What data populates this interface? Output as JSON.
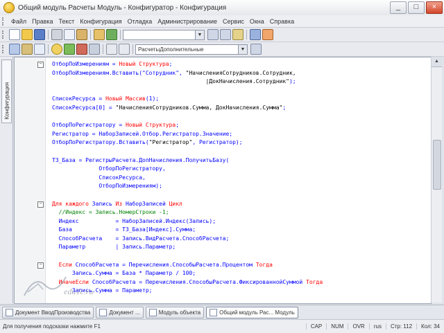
{
  "window": {
    "title": "Общий модуль Расчеты Модуль - Конфигуратор - Конфигурация",
    "min_label": "_",
    "max_label": "□",
    "close_label": "×"
  },
  "menu": {
    "items": [
      "Файл",
      "Правка",
      "Текст",
      "Конфигурация",
      "Отладка",
      "Администрирование",
      "Сервис",
      "Окна",
      "Справка"
    ]
  },
  "toolbar1": {
    "search_value": "",
    "icons": [
      "new-icon",
      "open-icon",
      "save-icon",
      "cut-icon",
      "copy-icon",
      "paste-icon",
      "undo-icon",
      "redo-icon",
      "find-icon",
      "replace-icon",
      "find-next-icon",
      "help-icon",
      "syntax-helper-icon"
    ]
  },
  "toolbar2": {
    "combo_value": "РасчетыДополнительные",
    "icons": [
      "config-icon",
      "db-icon",
      "window-icon",
      "debug-icon",
      "start-icon",
      "stop-icon",
      "step-icon",
      "module-icon",
      "procedure-icon"
    ]
  },
  "sidepanel": {
    "tab_label": "Конфигурация"
  },
  "editor": {
    "lines": [
      [
        {
          "t": "ОтборПоИзмерениям = ",
          "c": "#0000ff"
        },
        {
          "t": "Новый",
          "c": "#ff0000"
        },
        {
          "t": " ",
          "c": "#0000ff"
        },
        {
          "t": "Структура",
          "c": "#ff0000"
        },
        {
          "t": ";",
          "c": "#0000ff"
        }
      ],
      [
        {
          "t": "ОтборПоИзмерениям.Вставить(\"Сотрудник\", ",
          "c": "#0000ff"
        },
        {
          "t": "\"НачисленияСотрудников.Сотрудник,",
          "c": "#000000"
        }
      ],
      [
        {
          "t": "                                              |ДокНачисления.Сотрудник\"",
          "c": "#000000"
        },
        {
          "t": ");",
          "c": "#0000ff"
        }
      ],
      [
        {
          "t": "",
          "c": "#0000ff"
        }
      ],
      [
        {
          "t": "СписокРесурса = ",
          "c": "#0000ff"
        },
        {
          "t": "Новый Массив",
          "c": "#ff0000"
        },
        {
          "t": "(1);",
          "c": "#0000ff"
        }
      ],
      [
        {
          "t": "СписокРесурса[0] = ",
          "c": "#0000ff"
        },
        {
          "t": "\"НачисленияСотрудников.Сумма, ДокНачисления.Сумма\"",
          "c": "#000000"
        },
        {
          "t": ";",
          "c": "#0000ff"
        }
      ],
      [
        {
          "t": "",
          "c": "#0000ff"
        }
      ],
      [
        {
          "t": "ОтборПоРегистратору = ",
          "c": "#0000ff"
        },
        {
          "t": "Новый Структура",
          "c": "#ff0000"
        },
        {
          "t": ";",
          "c": "#0000ff"
        }
      ],
      [
        {
          "t": "Регистратор = НаборЗаписей.Отбор.Регистратор.Значение;",
          "c": "#0000ff"
        }
      ],
      [
        {
          "t": "ОтборПоРегистратору.Вставить(",
          "c": "#0000ff"
        },
        {
          "t": "\"Регистратор\"",
          "c": "#000000"
        },
        {
          "t": ", Регистратор);",
          "c": "#0000ff"
        }
      ],
      [
        {
          "t": "",
          "c": "#0000ff"
        }
      ],
      [
        {
          "t": "ТЗ_База = РегистрыРасчета.ДопНачисления.ПолучитьБазу(",
          "c": "#0000ff"
        }
      ],
      [
        {
          "t": "              ОтборПоРегистратору,",
          "c": "#0000ff"
        }
      ],
      [
        {
          "t": "              СписокРесурса,",
          "c": "#0000ff"
        }
      ],
      [
        {
          "t": "              ОтборПоИзмерениям);",
          "c": "#0000ff"
        }
      ],
      [
        {
          "t": "",
          "c": "#0000ff"
        }
      ],
      [
        {
          "t": "Для каждого",
          "c": "#ff0000"
        },
        {
          "t": " Запись ",
          "c": "#0000ff"
        },
        {
          "t": "Из",
          "c": "#ff0000"
        },
        {
          "t": " НаборЗаписей ",
          "c": "#0000ff"
        },
        {
          "t": "Цикл",
          "c": "#ff0000"
        }
      ],
      [
        {
          "t": "  //Индекс = Запись.НомерСтроки -1;",
          "c": "#008000"
        }
      ],
      [
        {
          "t": "  Индекс           = НаборЗаписей.Индекс(Запись);",
          "c": "#0000ff"
        }
      ],
      [
        {
          "t": "  База             = ТЗ_База[Индекс].Сумма;",
          "c": "#0000ff"
        }
      ],
      [
        {
          "t": "  СпособРасчета    = Запись.ВидРасчета.СпособРасчета;",
          "c": "#0000ff"
        }
      ],
      [
        {
          "t": "  Параметр         | Запись.Параметр;",
          "c": "#0000ff"
        }
      ],
      [
        {
          "t": "",
          "c": "#0000ff"
        }
      ],
      [
        {
          "t": "  ",
          "c": "#0000ff"
        },
        {
          "t": "Если",
          "c": "#ff0000"
        },
        {
          "t": " СпособРасчета = Перечисления.СпособыРасчета.Процентом ",
          "c": "#0000ff"
        },
        {
          "t": "Тогда",
          "c": "#ff0000"
        }
      ],
      [
        {
          "t": "      Запись.Сумма = База * Параметр / 100;",
          "c": "#0000ff"
        }
      ],
      [
        {
          "t": "  ",
          "c": "#0000ff"
        },
        {
          "t": "ИначеЕсли",
          "c": "#ff0000"
        },
        {
          "t": " СпособРасчета = Перечисления.СпособыРасчета.ФиксированнойСуммой ",
          "c": "#0000ff"
        },
        {
          "t": "Тогда",
          "c": "#ff0000"
        }
      ],
      [
        {
          "t": "      Запись.Сумма = Параметр;",
          "c": "#0000ff"
        }
      ]
    ],
    "markers": [
      {
        "line": 0,
        "sym": "−"
      },
      {
        "line": 16,
        "sym": "−"
      },
      {
        "line": 23,
        "sym": "−"
      }
    ]
  },
  "windows": [
    {
      "label": "Документ ВводПроизводства",
      "active": false
    },
    {
      "label": "Документ ...",
      "active": false
    },
    {
      "label": "Модуль объекта",
      "active": false
    },
    {
      "label": "Общий модуль Рас... Модуль",
      "active": true
    }
  ],
  "status": {
    "hint": "Для получения подсказки нажмите F1",
    "cap": "CAP",
    "num": "NUM",
    "ovr": "OVR",
    "lang": "rus",
    "line": "Стр: 112",
    "col": "Кол: 34"
  },
  "watermark": {
    "text": "edu1c.ru"
  }
}
